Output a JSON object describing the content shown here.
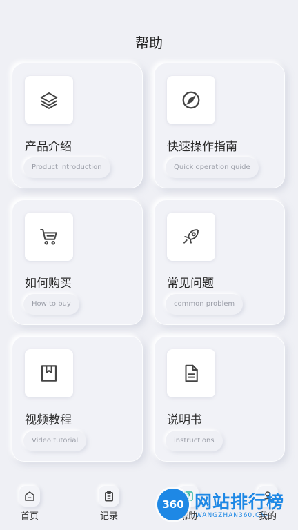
{
  "header": {
    "title": "帮助"
  },
  "cards": [
    {
      "title": "产品介绍",
      "subtitle": "Product introduction",
      "icon": "layers-icon"
    },
    {
      "title": "快速操作指南",
      "subtitle": "Quick operation guide",
      "icon": "compass-icon"
    },
    {
      "title": "如何购买",
      "subtitle": "How to buy",
      "icon": "cart-icon"
    },
    {
      "title": "常见问题",
      "subtitle": "common problem",
      "icon": "rocket-icon"
    },
    {
      "title": "视频教程",
      "subtitle": "Video tutorial",
      "icon": "bookmark-icon"
    },
    {
      "title": "说明书",
      "subtitle": "instructions",
      "icon": "document-icon"
    }
  ],
  "tabbar": {
    "items": [
      {
        "label": "首页",
        "icon": "home-icon"
      },
      {
        "label": "记录",
        "icon": "clipboard-icon"
      },
      {
        "label": "帮助",
        "icon": "help-icon",
        "active": true
      },
      {
        "label": "我的",
        "icon": "user-icon"
      }
    ]
  },
  "watermark": {
    "badge": "360",
    "text": "网站排行榜",
    "subtext": "-WANGZHAN360.CN-"
  },
  "colors": {
    "background": "#eff0f5",
    "icon_stroke": "#444444",
    "watermark": "#1e88e5",
    "help_accent": "#2bb5a0"
  }
}
